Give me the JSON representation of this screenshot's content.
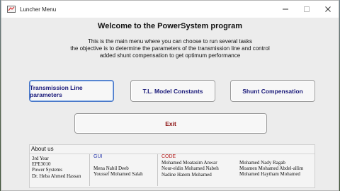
{
  "window": {
    "title": "Luncher Menu",
    "icon": "matlab-figure-icon",
    "controls": [
      "minimize-icon",
      "maximize-icon",
      "close-icon"
    ]
  },
  "heading": "Welcome to the PowerSystem program",
  "description": [
    "This is the main menu where you can choose to run several tasks",
    "the objective is to determine the parameters of the transmission line and control",
    "added shunt compensation to get optimum performance"
  ],
  "buttons": {
    "tl_params": "Transmission Line parameters",
    "tl_consts": "T.L.  Model Constants",
    "shunt": "Shunt Compensation",
    "exit": "Exit"
  },
  "colors": {
    "button_text": "#1a1a7a",
    "exit_text": "#8b1010",
    "gui_label": "#2233aa",
    "code_label": "#b51a1a"
  },
  "about": {
    "title": "About us",
    "info": [
      "3rd Year",
      "EPE3010",
      "Power Systems",
      "Dr. Heba Ahmed Hassan"
    ],
    "gui_label": "GUI",
    "gui_members": [
      "Mena Nabil Deeb",
      "Youssef Mohamed Salah"
    ],
    "code_label": "CODE",
    "code_members": [
      "Mohamed Moatasim Anwar",
      "Nour-eldin Mohamed Nabeh",
      "Nadine Hatem Mohamed"
    ],
    "code_members_2": [
      "Mohamed Nady Ragab",
      "Moamen Mohamed Abdel-allim",
      "Mohamed Haytham Mohamed"
    ]
  }
}
